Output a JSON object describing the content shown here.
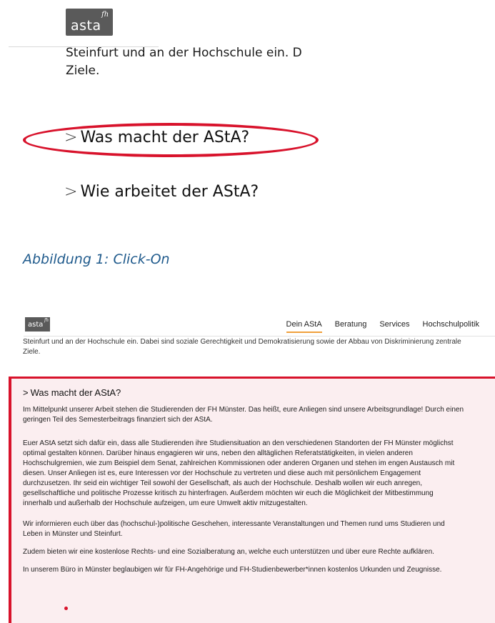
{
  "brand": {
    "logo_text": "asta",
    "logo_sup": "fh"
  },
  "zoomed": {
    "text_line1": "Steinfurt und an der Hochschule ein. Dab",
    "text_line2": "Ziele.",
    "chevron": ">",
    "heading1": "Was macht der AStA?",
    "heading2": "Wie arbeitet der AStA?"
  },
  "caption": "Abbildung 1: Click-On",
  "nav": {
    "items": [
      "Dein AStA",
      "Beratung",
      "Services",
      "Hochschulpolitik"
    ],
    "active": "Dein AStA",
    "accent": "#f0a03c"
  },
  "page": {
    "intro_line1": "Steinfurt und an der Hochschule ein. Dabei sind soziale Gerechtigkeit und Demokratisierung sowie der Abbau von Diskriminierung zentrale",
    "intro_line2": "Ziele.",
    "section_title": "Was macht der AStA?",
    "paragraph1": [
      "Im Mittelpunkt unserer Arbeit stehen die Studierenden der FH Münster. Das heißt, eure Anliegen sind unsere Arbeitsgrundlage! Durch einen",
      "geringen Teil des Semesterbeitrags finanziert sich der AStA."
    ],
    "paragraph2": [
      "Euer AStA setzt sich dafür ein, dass alle Studierenden ihre Studiensituation an den verschiedenen Standorten der FH Münster möglichst",
      "optimal gestalten können. Darüber hinaus engagieren wir uns, neben den alltäglichen Referatstätigkeiten, in vielen anderen",
      "Hochschulgremien, wie zum Beispiel dem Senat, zahlreichen Kommissionen oder anderen Organen und stehen im engen Austausch mit",
      "diesen. Unser Anliegen ist es, eure Interessen vor der Hochschule zu vertreten und diese auch mit persönlichem Engagement",
      "durchzusetzen. Ihr seid ein wichtiger Teil sowohl der Gesellschaft, als auch der Hochschule. Deshalb wollen wir euch anregen,",
      "gesellschaftliche und politische Prozesse kritisch zu hinterfragen. Außerdem möchten wir euch die Möglichkeit der Mitbestimmung",
      "innerhalb und außerhalb der Hochschule aufzeigen, um eure Umwelt aktiv mitzugestalten."
    ],
    "paragraph3": [
      "Wir informieren euch über das (hochschul-)politische Geschehen, interessante Veranstaltungen und Themen rund ums Studieren und",
      "Leben in Münster und Steinfurt."
    ],
    "paragraph4": "Zudem bieten wir eine kostenlose Rechts- und eine Sozialberatung an, welche euch unterstützen und über eure Rechte aufklären.",
    "paragraph5": "In unserem Büro in Münster beglaubigen wir für FH-Angehörige und FH-Studienbewerber*innen kostenlos Urkunden und Zeugnisse."
  },
  "colors": {
    "highlight_red": "#d8122b",
    "panel_bg": "#fbeef0",
    "caption_blue": "#1f5a8c"
  }
}
